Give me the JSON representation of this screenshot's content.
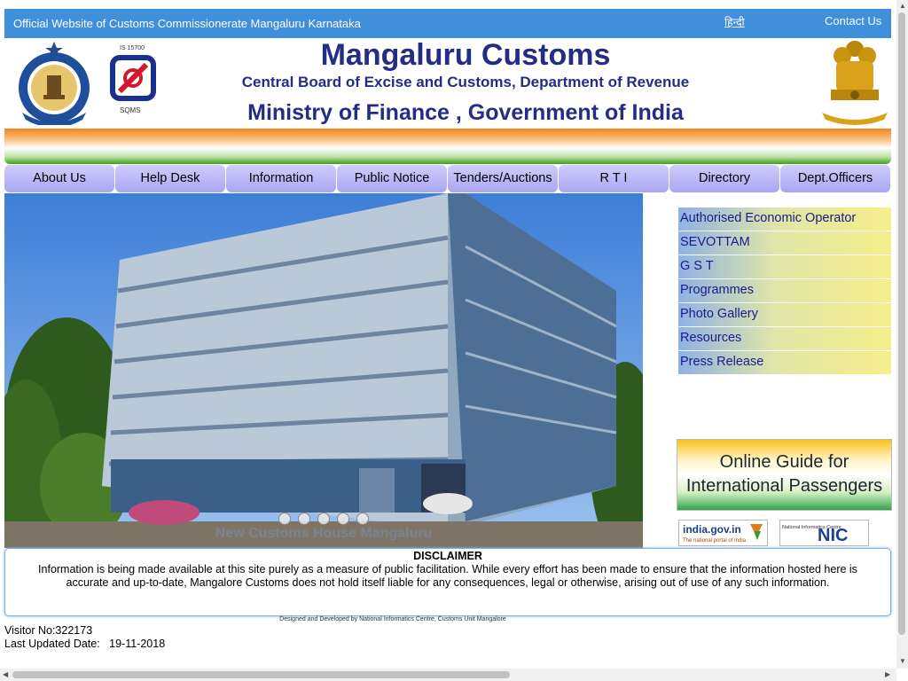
{
  "topbar": {
    "site_title": "Official Website of Customs Commissionerate Mangaluru Karnataka",
    "hindi_link": "हिन्दी",
    "contact_link": "Contact Us"
  },
  "header": {
    "title": "Mangaluru Customs",
    "subtitle": "Central Board of Excise and Customs, Department of Revenue",
    "ministry": "Ministry of Finance , Government of India",
    "sqms_standard": "IS 15700",
    "sqms_label": "SQMS"
  },
  "nav": {
    "items": [
      {
        "label": "About Us"
      },
      {
        "label": "Help Desk"
      },
      {
        "label": "Information"
      },
      {
        "label": "Public Notice"
      },
      {
        "label": "Tenders/Auctions"
      },
      {
        "label": "R T I"
      },
      {
        "label": "Directory"
      },
      {
        "label": "Dept.Officers"
      }
    ]
  },
  "slider": {
    "caption": "New Customs House Mangaluru",
    "slide_count": 5,
    "active_slide": 1
  },
  "side_menu": {
    "items": [
      {
        "label": "Authorised Economic Operator"
      },
      {
        "label": "SEVOTTAM"
      },
      {
        "label": "G S T"
      },
      {
        "label": "Programmes"
      },
      {
        "label": "Photo Gallery"
      },
      {
        "label": "Resources"
      },
      {
        "label": "Press Release"
      }
    ]
  },
  "guide_banner": {
    "line1": "Online Guide for",
    "line2": "International Passengers"
  },
  "badges": {
    "indiagov_title": "india.gov.in",
    "indiagov_sub": "The national portal of India",
    "nic_small": "National Informatics Centre",
    "nic_big": "NIC"
  },
  "disclaimer": {
    "title": "DISCLAIMER",
    "body": "Information is being made available at this site purely as a measure of public facilitation. While every effort has been made to ensure that the information hosted here is accurate and up-to-date, Mangalore Customs does not hold itself liable for any consequences, legal or otherwise, arising out of use of any such information."
  },
  "footer": {
    "designed_by": "Designed and Developed by National Informatics Centre, Customs Unit Mangalore",
    "visitor": "Visitor No:322173",
    "last_updated": "Last Updated Date:   19-11-2018"
  },
  "colors": {
    "topbar": "#3f8fdc",
    "heading": "#232d86",
    "nav": "#b9b6f6"
  }
}
